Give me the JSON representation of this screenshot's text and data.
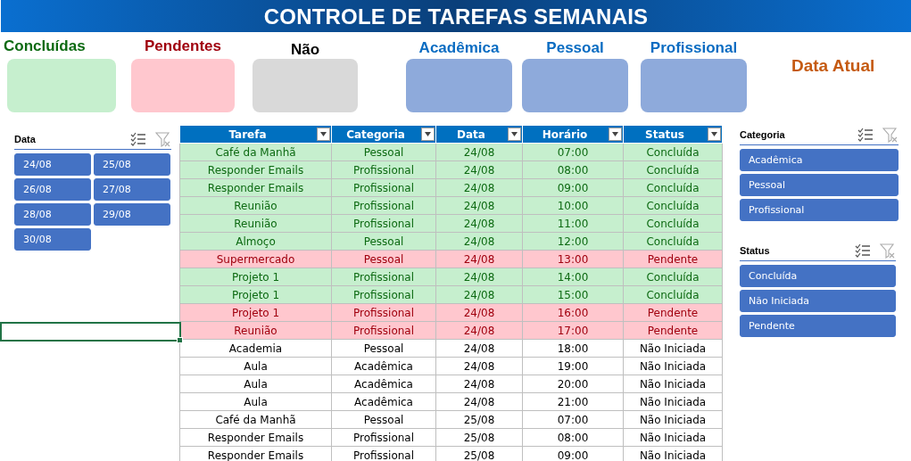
{
  "title": "CONTROLE DE TAREFAS SEMANAIS",
  "kpis": [
    {
      "label": "Concluídas",
      "kind": "done"
    },
    {
      "label": "Pendentes",
      "kind": "pending"
    },
    {
      "label": "Não",
      "kind": "not_started"
    },
    {
      "label": "Acadêmica",
      "kind": "category"
    },
    {
      "label": "Pessoal",
      "kind": "category"
    },
    {
      "label": "Profissional",
      "kind": "category"
    }
  ],
  "current_date_label": "Data Atual",
  "date_slicer": {
    "title": "Data",
    "items": [
      {
        "label": "24/08",
        "selected": true
      },
      {
        "label": "25/08",
        "selected": true
      },
      {
        "label": "26/08",
        "selected": true
      },
      {
        "label": "27/08",
        "selected": true
      },
      {
        "label": "28/08",
        "selected": true
      },
      {
        "label": "29/08",
        "selected": true
      },
      {
        "label": "30/08",
        "selected": true
      }
    ]
  },
  "table": {
    "columns": [
      "Tarefa",
      "Categoria",
      "Data",
      "Horário",
      "Status"
    ],
    "rows": [
      {
        "kind": "done",
        "cells": [
          "Café da Manhã",
          "Pessoal",
          "24/08",
          "07:00",
          "Concluída"
        ]
      },
      {
        "kind": "done",
        "cells": [
          "Responder Emails",
          "Profissional",
          "24/08",
          "08:00",
          "Concluída"
        ]
      },
      {
        "kind": "done",
        "cells": [
          "Responder Emails",
          "Profissional",
          "24/08",
          "09:00",
          "Concluída"
        ]
      },
      {
        "kind": "done",
        "cells": [
          "Reunião",
          "Profissional",
          "24/08",
          "10:00",
          "Concluída"
        ]
      },
      {
        "kind": "done",
        "cells": [
          "Reunião",
          "Profissional",
          "24/08",
          "11:00",
          "Concluída"
        ]
      },
      {
        "kind": "done",
        "cells": [
          "Almoço",
          "Pessoal",
          "24/08",
          "12:00",
          "Concluída"
        ]
      },
      {
        "kind": "pending",
        "cells": [
          "Supermercado",
          "Pessoal",
          "24/08",
          "13:00",
          "Pendente"
        ]
      },
      {
        "kind": "done",
        "cells": [
          "Projeto 1",
          "Profissional",
          "24/08",
          "14:00",
          "Concluída"
        ]
      },
      {
        "kind": "done",
        "cells": [
          "Projeto 1",
          "Profissional",
          "24/08",
          "15:00",
          "Concluída"
        ]
      },
      {
        "kind": "pending",
        "cells": [
          "Projeto 1",
          "Profissional",
          "24/08",
          "16:00",
          "Pendente"
        ]
      },
      {
        "kind": "pending",
        "cells": [
          "Reunião",
          "Profissional",
          "24/08",
          "17:00",
          "Pendente"
        ]
      },
      {
        "kind": "not_started",
        "cells": [
          "Academia",
          "Pessoal",
          "24/08",
          "18:00",
          "Não Iniciada"
        ]
      },
      {
        "kind": "not_started",
        "cells": [
          "Aula",
          "Acadêmica",
          "24/08",
          "19:00",
          "Não Iniciada"
        ]
      },
      {
        "kind": "not_started",
        "cells": [
          "Aula",
          "Acadêmica",
          "24/08",
          "20:00",
          "Não Iniciada"
        ]
      },
      {
        "kind": "not_started",
        "cells": [
          "Aula",
          "Acadêmica",
          "24/08",
          "21:00",
          "Não Iniciada"
        ]
      },
      {
        "kind": "not_started",
        "cells": [
          "Café da Manhã",
          "Pessoal",
          "25/08",
          "07:00",
          "Não Iniciada"
        ]
      },
      {
        "kind": "not_started",
        "cells": [
          "Responder Emails",
          "Profissional",
          "25/08",
          "08:00",
          "Não Iniciada"
        ]
      },
      {
        "kind": "not_started",
        "cells": [
          "Responder Emails",
          "Profissional",
          "25/08",
          "09:00",
          "Não Iniciada"
        ]
      }
    ]
  },
  "category_slicer": {
    "title": "Categoria",
    "items": [
      {
        "label": "Acadêmica",
        "selected": true
      },
      {
        "label": "Pessoal",
        "selected": true
      },
      {
        "label": "Profissional",
        "selected": true
      }
    ]
  },
  "status_slicer": {
    "title": "Status",
    "items": [
      {
        "label": "Concluída",
        "selected": true
      },
      {
        "label": "Não Iniciada",
        "selected": true
      },
      {
        "label": "Pendente",
        "selected": true
      }
    ]
  }
}
